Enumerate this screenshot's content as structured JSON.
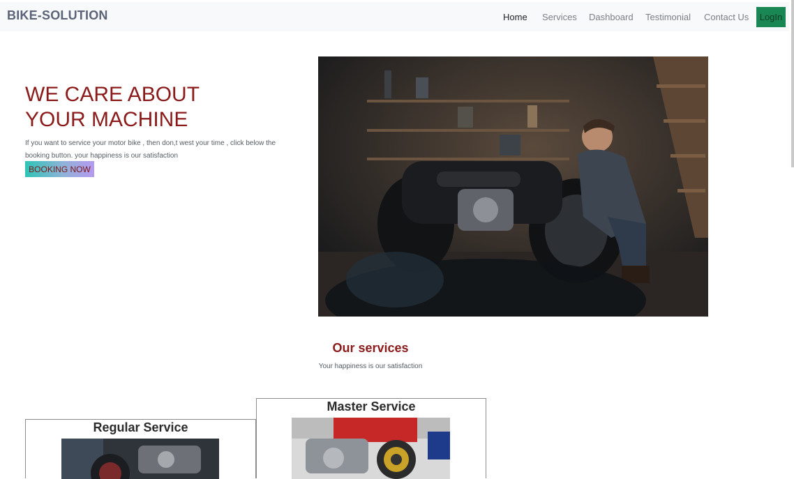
{
  "navbar": {
    "brand": "BIKE-SOLUTION",
    "links": [
      "Home",
      "Services",
      "Dashboard",
      "Testimonial",
      "Contact Us"
    ],
    "login_label": "LogIn"
  },
  "hero": {
    "title_line1": "WE CARE ABOUT",
    "title_line2": "YOUR MACHINE",
    "description": "If you want to service your motor bike , then don,t west your time , click below the booking button. your happiness is our satisfaction",
    "booking_label": "BOOKING NOW"
  },
  "services": {
    "title": "Our services",
    "subtitle": "Your happiness is our satisfaction",
    "cards": [
      {
        "title": "Regular Service"
      },
      {
        "title": "Master Service"
      }
    ]
  },
  "colors": {
    "accent": "#8b1a1a",
    "login": "#198754",
    "navbar_bg": "#f8f9fa"
  }
}
